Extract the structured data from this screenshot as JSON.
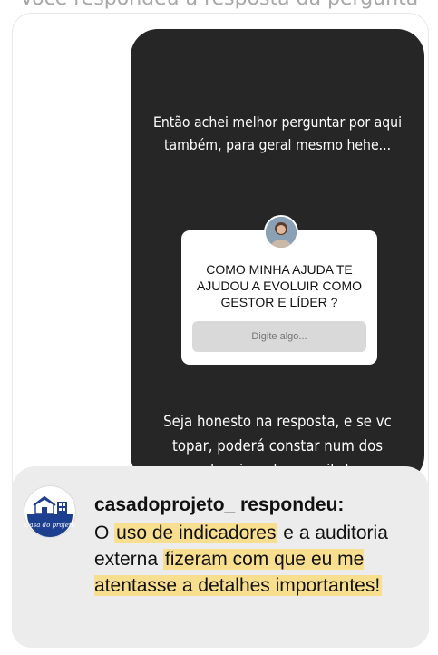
{
  "top_cut_text": "Você respondeu à resposta da pergunta",
  "story": {
    "text_top": "Então achei melhor perguntar por aqui também, para geral mesmo hehe...",
    "question_box": {
      "question": "COMO MINHA AJUDA TE AJUDOU A EVOLUIR COMO GESTOR E LÍDER ?",
      "input_placeholder": "Digite algo..."
    },
    "text_bottom": "Seja honesto na resposta, e se vc topar, poderá constar num dos depoimentos no site!"
  },
  "reply": {
    "username": "casadoprojeto_ respondeu:",
    "avatar_caption": "Casa do projeto",
    "segments": [
      {
        "text": "O ",
        "highlight": false
      },
      {
        "text": "uso de indicadores",
        "highlight": true
      },
      {
        "text": " e a auditoria externa ",
        "highlight": false
      },
      {
        "text": "fizeram com que eu me atentasse a detalhes importantes!",
        "highlight": true
      }
    ],
    "highlight_color": "#f8df8f"
  }
}
